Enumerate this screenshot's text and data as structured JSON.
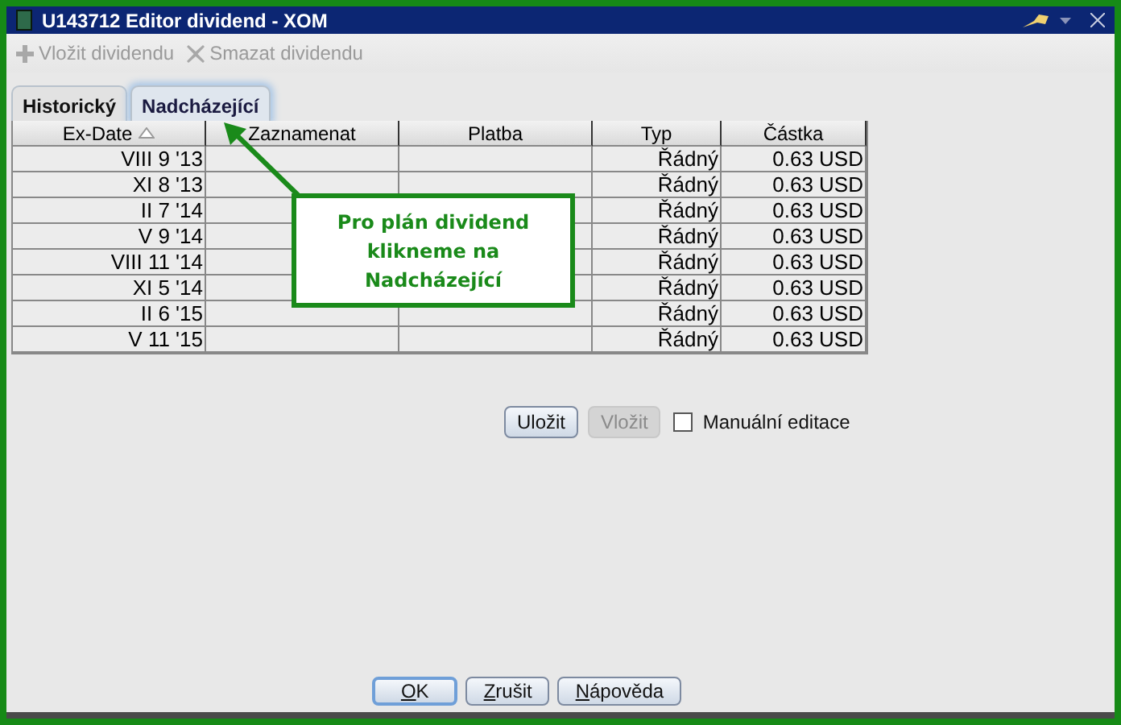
{
  "window": {
    "title": "U143712 Editor dividend - XOM"
  },
  "toolbar": [
    {
      "kind": "add",
      "label": "Vložit dividendu",
      "disabled": true
    },
    {
      "kind": "delete",
      "label": "Smazat dividendu",
      "disabled": true
    }
  ],
  "tabs": [
    {
      "label": "Historický",
      "selected": false
    },
    {
      "label": "Nadcházející",
      "selected": true
    }
  ],
  "table": {
    "columns": [
      {
        "label": "Ex-Date",
        "sorted": true
      },
      {
        "label": "Zaznamenat",
        "sorted": false
      },
      {
        "label": "Platba",
        "sorted": false
      },
      {
        "label": "Typ",
        "sorted": false
      },
      {
        "label": "Částka",
        "sorted": false
      }
    ],
    "rows": [
      [
        "VIII 9 '13",
        null,
        null,
        "Řádný",
        "0.63 USD"
      ],
      [
        "XI 8 '13",
        null,
        null,
        "Řádný",
        "0.63 USD"
      ],
      [
        "II 7 '14",
        null,
        null,
        "Řádný",
        "0.63 USD"
      ],
      [
        "V 9 '14",
        null,
        null,
        "Řádný",
        "0.63 USD"
      ],
      [
        "VIII 11 '14",
        null,
        null,
        "Řádný",
        "0.63 USD"
      ],
      [
        "XI 5 '14",
        null,
        null,
        "Řádný",
        "0.63 USD"
      ],
      [
        "II 6 '15",
        null,
        null,
        "Řádný",
        "0.63 USD"
      ],
      [
        "V 11 '15",
        null,
        null,
        "Řádný",
        "0.63 USD"
      ]
    ]
  },
  "actions": [
    {
      "label": "Uložit",
      "disabled": false
    },
    {
      "label": "Vložit",
      "disabled": true
    }
  ],
  "manual_edit": {
    "label": "Manuální editace",
    "checked": false
  },
  "callout": {
    "text": "Pro plán dividend klikneme na Nadcházející"
  },
  "buttons": [
    {
      "label": "OK",
      "default": true
    },
    {
      "label": "Zrušit",
      "default": false
    },
    {
      "label": "Nápověda",
      "default": false
    }
  ]
}
